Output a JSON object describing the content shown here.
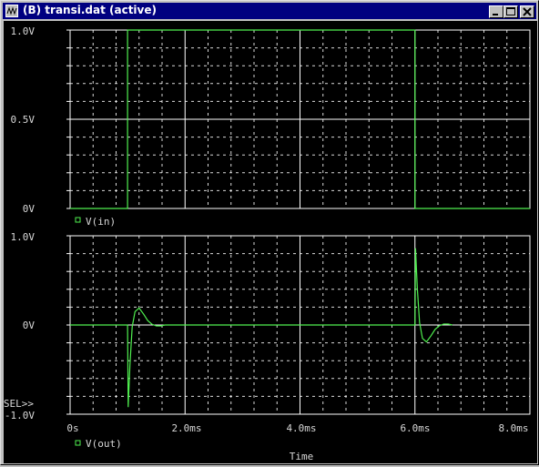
{
  "window": {
    "title": "(B) transi.dat (active)",
    "icon": "probe-app-icon",
    "controls": {
      "minimize": "minimize-icon",
      "maximize": "maximize-icon",
      "close": "close-icon"
    }
  },
  "colors": {
    "background": "#000000",
    "trace": "#4ff04f",
    "grid": "#ffffff",
    "text": "#d8d8d8",
    "titlebar": "#000080"
  },
  "chart_data": [
    {
      "type": "line",
      "ylim": [
        0,
        1
      ],
      "xlim": [
        0,
        8
      ],
      "yticks": [
        "1.0V",
        "0.5V",
        "0V"
      ],
      "grid": true,
      "legend": "V(in)",
      "series": [
        {
          "name": "V(in)",
          "x": [
            0,
            1,
            1,
            6,
            6,
            8
          ],
          "y": [
            0,
            0,
            1,
            1,
            0,
            0
          ]
        }
      ]
    },
    {
      "type": "line",
      "ylim": [
        -1,
        1
      ],
      "xlim": [
        0,
        8
      ],
      "yticks": [
        "1.0V",
        "0V",
        "-1.0V"
      ],
      "xticks": [
        "0s",
        "2.0ms",
        "4.0ms",
        "6.0ms",
        "8.0ms"
      ],
      "xlabel": "Time",
      "grid": true,
      "legend": "V(out)",
      "sel_marker": "SEL>>",
      "series": [
        {
          "name": "V(out)",
          "x": [
            0,
            1,
            1.01,
            1.04,
            1.08,
            1.13,
            1.2,
            1.28,
            1.35,
            1.42,
            1.5,
            1.58,
            1.65,
            6,
            6.01,
            6.04,
            6.08,
            6.13,
            6.2,
            6.28,
            6.35,
            6.42,
            6.5,
            6.58,
            6.65
          ],
          "y": [
            0,
            0,
            -0.92,
            -0.45,
            -0.02,
            0.15,
            0.19,
            0.12,
            0.05,
            0.01,
            -0.01,
            -0.01,
            0,
            0,
            0.86,
            0.42,
            0.03,
            -0.15,
            -0.19,
            -0.12,
            -0.05,
            -0.01,
            0.01,
            0.01,
            0
          ]
        }
      ]
    }
  ]
}
